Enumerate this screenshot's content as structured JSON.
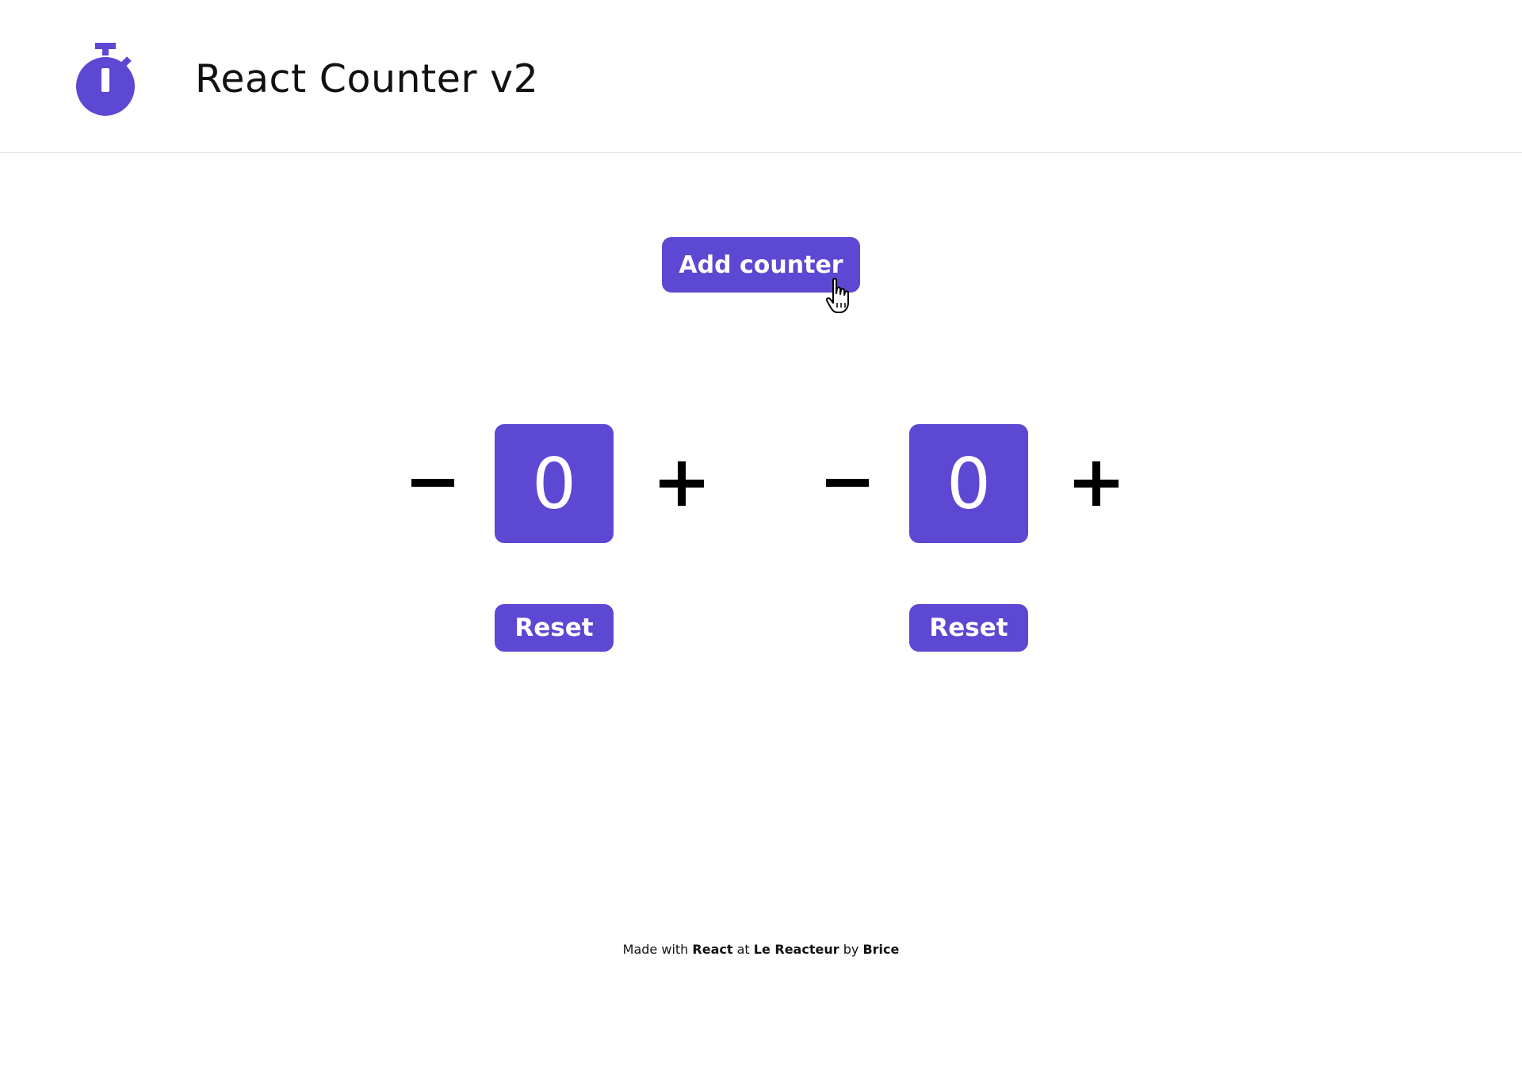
{
  "header": {
    "logo_icon": "stopwatch-icon",
    "title": "React Counter v2"
  },
  "toolbar": {
    "add_counter_label": "Add counter"
  },
  "counters": [
    {
      "value": "0",
      "decrement_icon": "minus-icon",
      "increment_icon": "plus-icon",
      "reset_label": "Reset"
    },
    {
      "value": "0",
      "decrement_icon": "minus-icon",
      "increment_icon": "plus-icon",
      "reset_label": "Reset"
    }
  ],
  "footer": {
    "made_with": "Made with",
    "react": "React",
    "at": "at",
    "school": "Le Reacteur",
    "by": "by",
    "author": "Brice"
  },
  "colors": {
    "accent": "#5c48d3",
    "text": "#111111",
    "background": "#ffffff"
  }
}
